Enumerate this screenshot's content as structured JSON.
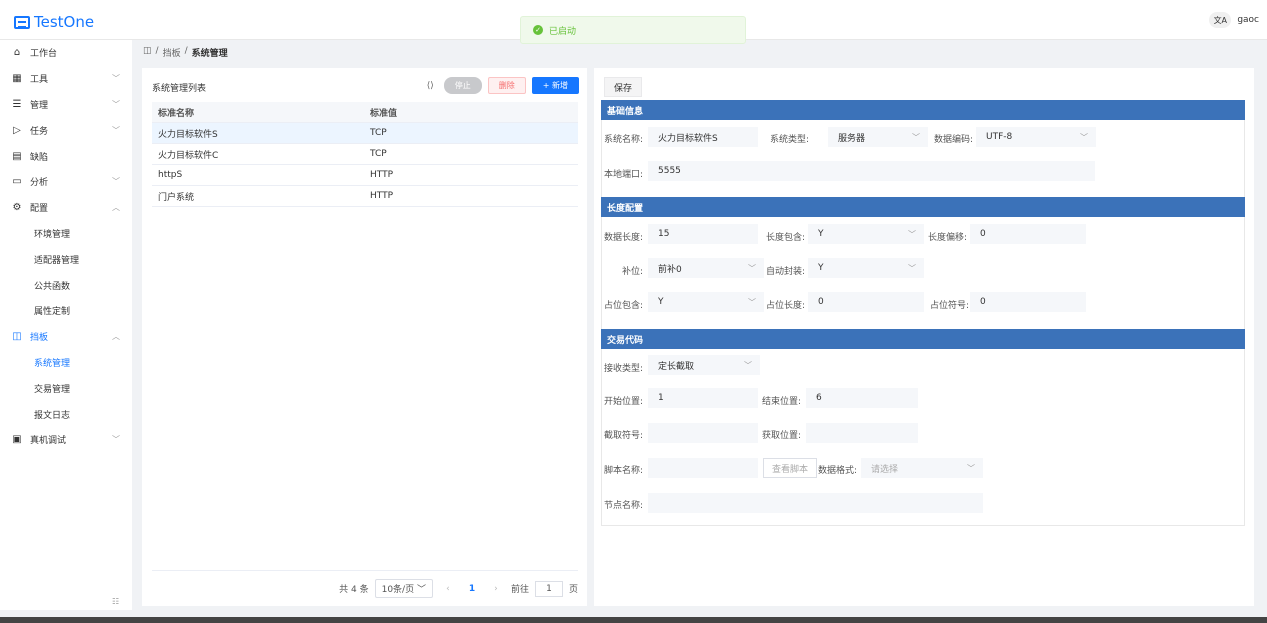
{
  "app": {
    "title": "TestOne",
    "user": "gaoc",
    "lang_icon": "translate-icon"
  },
  "toast": {
    "text": "已启动"
  },
  "sidebar": {
    "items": [
      {
        "label": "工作台",
        "icon": "home-icon",
        "chev": ""
      },
      {
        "label": "工具",
        "icon": "grid-icon",
        "chev": "﹀"
      },
      {
        "label": "管理",
        "icon": "list-icon",
        "chev": "﹀"
      },
      {
        "label": "任务",
        "icon": "play-icon",
        "chev": "﹀"
      },
      {
        "label": "缺陷",
        "icon": "doc-icon",
        "chev": ""
      },
      {
        "label": "分析",
        "icon": "chart-icon",
        "chev": "﹀"
      },
      {
        "label": "配置",
        "icon": "gear-icon",
        "chev": "︿"
      },
      {
        "label": "环境管理",
        "sub": true
      },
      {
        "label": "适配器管理",
        "sub": true
      },
      {
        "label": "公共函数",
        "sub": true
      },
      {
        "label": "属性定制",
        "sub": true
      },
      {
        "label": "挡板",
        "icon": "panel-icon",
        "chev": "︿",
        "active": true
      },
      {
        "label": "系统管理",
        "sub": true,
        "current": true
      },
      {
        "label": "交易管理",
        "sub": true
      },
      {
        "label": "报文日志",
        "sub": true
      },
      {
        "label": "真机调试",
        "icon": "device-icon",
        "chev": "﹀"
      }
    ]
  },
  "breadcrumb": {
    "home": "◫",
    "sep": "/",
    "level1": "挡板",
    "level2": "系统管理"
  },
  "list": {
    "title": "系统管理列表",
    "refresh": "⟨⟩",
    "stop_label": "停止",
    "delete_label": "删除",
    "add_label": "+ 新增",
    "columns": [
      "标准名称",
      "标准值"
    ],
    "rows": [
      [
        "火力目标软件S",
        "TCP"
      ],
      [
        "火力目标软件C",
        "TCP"
      ],
      [
        "httpS",
        "HTTP"
      ],
      [
        "门户系统",
        "HTTP"
      ]
    ],
    "pager": {
      "total": "共 4 条",
      "size": "10条/页",
      "page": "1",
      "goto_prefix": "前往",
      "goto_value": "1",
      "goto_suffix": "页"
    }
  },
  "form": {
    "save_label": "保存",
    "sec_basic": "基础信息",
    "sys_name_label": "系统名称:",
    "sys_name": "火力目标软件S",
    "sys_type_label": "系统类型:",
    "sys_type": "服务器",
    "encoding_label": "数据编码:",
    "encoding": "UTF-8",
    "port_label": "本地端口:",
    "port": "5555",
    "sec_length": "长度配置",
    "data_len_label": "数据长度:",
    "data_len": "15",
    "len_incl_label": "长度包含:",
    "len_incl": "Y",
    "len_offset_label": "长度偏移:",
    "len_offset": "0",
    "pad_label": "补位:",
    "pad": "前补0",
    "auto_wrap_label": "自动封装:",
    "auto_wrap": "Y",
    "ph_incl_label": "占位包含:",
    "ph_incl": "Y",
    "ph_len_label": "占位长度:",
    "ph_len": "0",
    "ph_char_label": "占位符号:",
    "ph_char": "0",
    "sec_trade": "交易代码",
    "recv_type_label": "接收类型:",
    "recv_type": "定长截取",
    "start_label": "开始位置:",
    "start": "1",
    "end_label": "结束位置:",
    "end": "6",
    "cut_char_label": "截取符号:",
    "get_pos_label": "获取位置:",
    "script_label": "脚本名称:",
    "view_script": "查看脚本",
    "data_fmt_label": "数据格式:",
    "data_fmt_ph": "请选择",
    "node_label": "节点名称:"
  }
}
